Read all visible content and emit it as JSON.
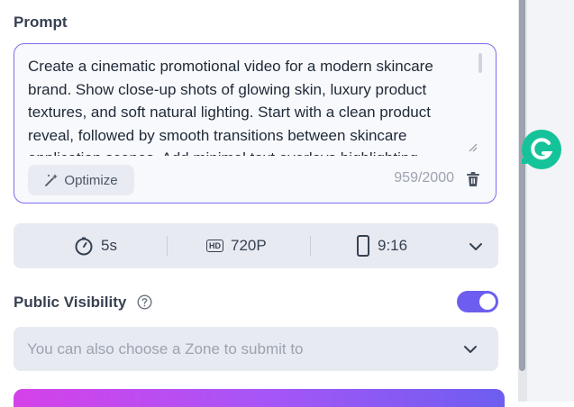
{
  "prompt": {
    "title": "Prompt",
    "text": "Create a cinematic promotional video for a modern skincare brand. Show close-up shots of glowing skin, luxury product textures, and soft natural lighting. Start with a clean product reveal, followed by smooth transitions between skincare application scenes. Add minimal text overlays highlighting",
    "optimize_label": "Optimize",
    "counter": "959/2000"
  },
  "settings": {
    "duration": "5s",
    "quality": "720P",
    "quality_badge": "HD",
    "aspect_ratio": "9:16"
  },
  "visibility": {
    "title": "Public Visibility",
    "enabled": true
  },
  "zone": {
    "placeholder": "You can also choose a Zone to submit to"
  },
  "colors": {
    "accent": "#6d5ef0",
    "grammarly": "#15c39a"
  },
  "icons": [
    "sparkle-wand-icon",
    "trash-icon",
    "timer-icon",
    "hd-icon",
    "phone-portrait-icon",
    "chevron-down-icon",
    "help-circle-icon",
    "grammarly-icon"
  ]
}
